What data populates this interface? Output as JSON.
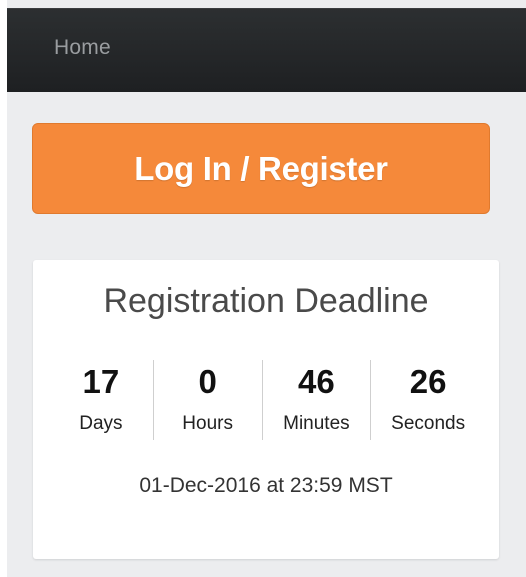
{
  "navbar": {
    "home_label": "Home"
  },
  "login_button": {
    "label": "Log In / Register"
  },
  "countdown": {
    "title": "Registration Deadline",
    "units": [
      {
        "value": "17",
        "label": "Days"
      },
      {
        "value": "0",
        "label": "Hours"
      },
      {
        "value": "46",
        "label": "Minutes"
      },
      {
        "value": "26",
        "label": "Seconds"
      }
    ],
    "deadline": "01-Dec-2016 at 23:59 MST"
  },
  "colors": {
    "accent": "#f5893a",
    "navbar_bg": "#222426",
    "page_bg": "#ecedef"
  }
}
